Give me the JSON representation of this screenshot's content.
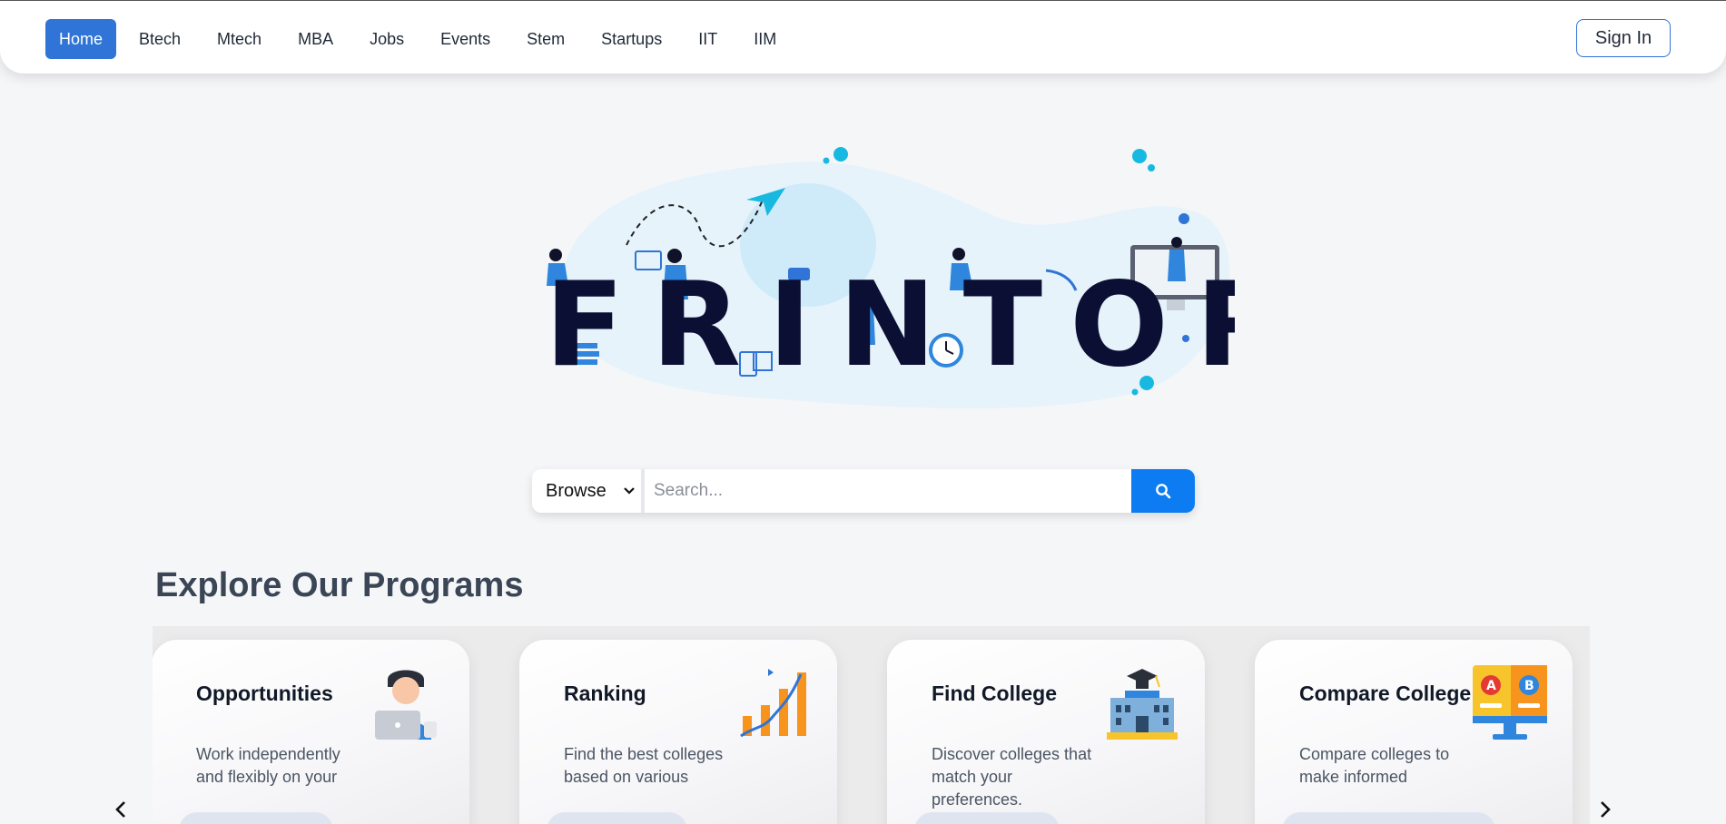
{
  "nav": {
    "links": [
      "Home",
      "Btech",
      "Mtech",
      "MBA",
      "Jobs",
      "Events",
      "Stem",
      "Startups",
      "IIT",
      "IIM"
    ],
    "signin_label": "Sign In"
  },
  "hero": {
    "logo_text": "FRINTOR"
  },
  "search": {
    "browse_label": "Browse",
    "placeholder": "Search..."
  },
  "programs": {
    "title": "Explore Our Programs",
    "cards": [
      {
        "title": "Opportunities",
        "desc": "Work independently and flexibly on your",
        "icon": "freelancer-laptop-icon"
      },
      {
        "title": "Ranking",
        "desc": "Find the best colleges based on various",
        "icon": "bar-chart-growth-icon"
      },
      {
        "title": "Find College",
        "desc": "Discover colleges that match your preferences.",
        "icon": "college-building-icon"
      },
      {
        "title": "Compare College",
        "desc": "Compare colleges to make informed",
        "icon": "compare-ab-monitor-icon"
      }
    ]
  },
  "colors": {
    "primary": "#2f74d6",
    "search_button": "#0d7cf2",
    "logo_text": "#0b0f33"
  }
}
